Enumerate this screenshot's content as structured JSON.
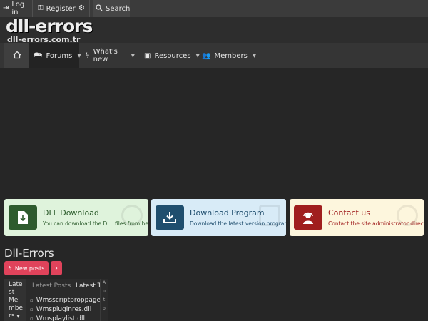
{
  "topbar": {
    "login": {
      "label": "Log in",
      "icon": "login-icon"
    },
    "register": {
      "label": "Register",
      "icon": "key-icon"
    },
    "settings": {
      "icon": "gear-icon"
    },
    "search": {
      "label": "Search",
      "icon": "search-icon"
    }
  },
  "logo": {
    "main": "dll-errors",
    "sub": "dll-errors.com.tr"
  },
  "nav": {
    "home": {
      "icon": "home-icon"
    },
    "items": [
      {
        "label": "Forums",
        "icon": "comments-icon"
      },
      {
        "label": "What's new",
        "icon": "bolt-icon"
      },
      {
        "label": "Resources",
        "icon": "box-icon"
      },
      {
        "label": "Members",
        "icon": "users-icon"
      }
    ]
  },
  "cards": [
    {
      "title": "DLL Download",
      "subtitle": "You can download the DLL files from here",
      "icon": "file-download-icon",
      "bg": "#dff3dc",
      "iconbg": "#2e5b2e",
      "titlecolor": "#2b5b2b"
    },
    {
      "title": "Download Program",
      "subtitle": "Download the latest version programs",
      "icon": "download-tray-icon",
      "bg": "#d8ebf7",
      "iconbg": "#1f4e6e",
      "titlecolor": "#1f4e6e"
    },
    {
      "title": "Contact us",
      "subtitle": "Contact the site administrator directly",
      "icon": "support-agent-icon",
      "bg": "#fdf6dd",
      "iconbg": "#a01e1e",
      "titlecolor": "#a01e1e"
    }
  ],
  "page": {
    "title": "Dll-Errors"
  },
  "actions": {
    "new_posts": "New posts",
    "more_icon": "chevron-right-icon"
  },
  "widget": {
    "members_lines": [
      "Late",
      "st",
      "Me",
      "mbe",
      "rs"
    ],
    "tabs": [
      "Latest Posts",
      "Latest T"
    ],
    "files": [
      "Wmsscriptproppage",
      "Wmspluginres.dll",
      "Wmsplaylist.dll"
    ],
    "side_letters": [
      "A",
      "u",
      "t",
      "o"
    ]
  },
  "colors": {
    "accent": "#e0435b",
    "background": "#262626",
    "nav": "#353535"
  }
}
